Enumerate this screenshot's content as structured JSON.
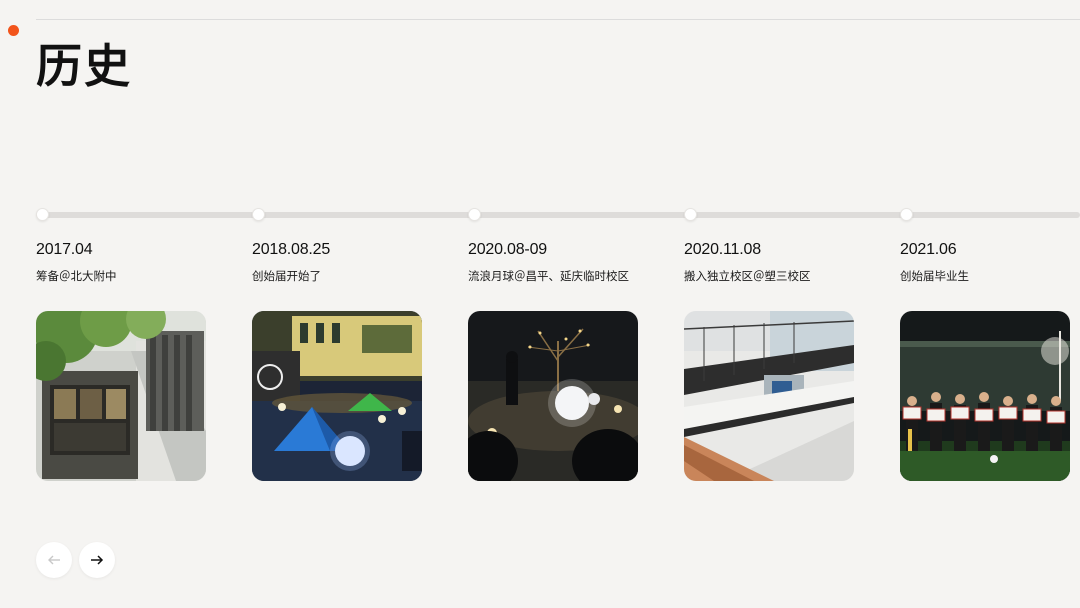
{
  "page": {
    "title": "历史"
  },
  "colors": {
    "accent": "#f2541b",
    "arrow_disabled": "#c8c8c8",
    "arrow_active": "#111111"
  },
  "timeline": [
    {
      "date": "2017.04",
      "desc": "筹备＠北大附中",
      "photo": "photo-building-stairs"
    },
    {
      "date": "2018.08.25",
      "desc": "创始届开始了",
      "photo": "photo-gym-tents"
    },
    {
      "date": "2020.08-09",
      "desc": "流浪月球＠昌平、延庆临时校区",
      "photo": "photo-night-moon-lamps"
    },
    {
      "date": "2020.11.08",
      "desc": "搬入独立校区＠塑三校区",
      "photo": "photo-atrium-interior"
    },
    {
      "date": "2021.06",
      "desc": "创始届毕业生",
      "photo": "photo-graduates"
    }
  ],
  "nav": {
    "prev_icon": "arrow-left-icon",
    "next_icon": "arrow-right-icon"
  }
}
